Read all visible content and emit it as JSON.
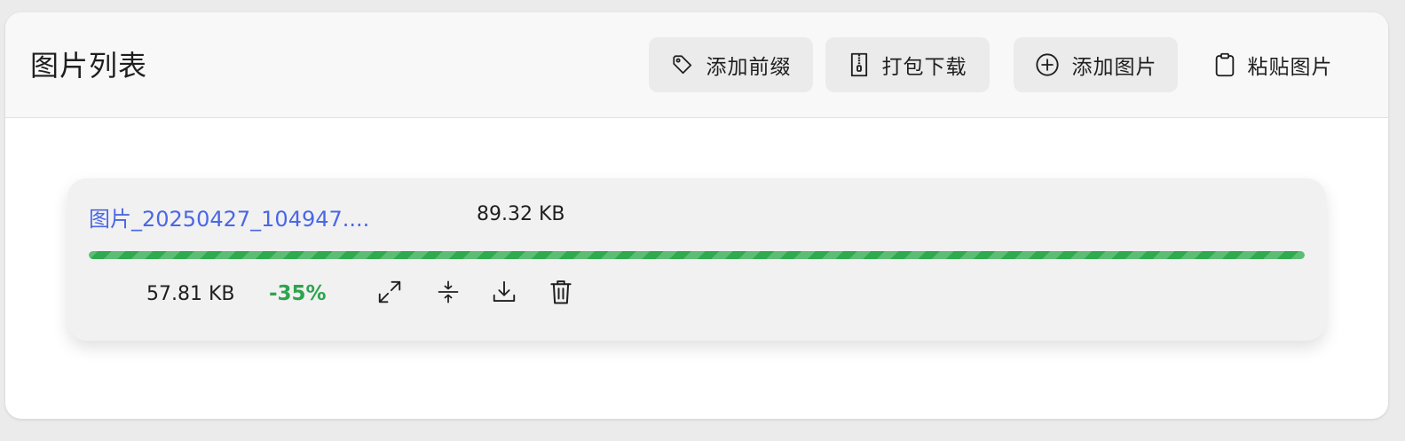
{
  "header": {
    "title": "图片列表",
    "buttons": {
      "add_prefix": "添加前缀",
      "zip_download": "打包下载",
      "add_image": "添加图片",
      "paste_image": "粘贴图片"
    },
    "icons": {
      "add_prefix": "tag-icon",
      "zip_download": "zip-file-icon",
      "add_image": "plus-circle-icon",
      "paste_image": "clipboard-icon"
    }
  },
  "files": [
    {
      "name": "图片_20250427_104947....",
      "original_size": "89.32 KB",
      "compressed_size": "57.81 KB",
      "reduction": "-35%",
      "progress": 1.0,
      "actions": [
        "expand-icon",
        "compress-icon",
        "download-icon",
        "trash-icon"
      ]
    }
  ],
  "colors": {
    "accent_link": "#4a67e6",
    "success": "#2da44e",
    "progress": "#2faa4e"
  }
}
